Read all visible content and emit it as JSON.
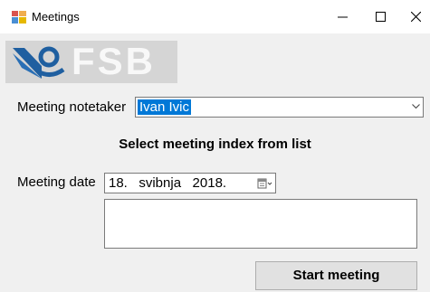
{
  "window": {
    "title": "Meetings",
    "icons": {
      "app": "app-icon",
      "minimize": "minimize-icon",
      "maximize": "maximize-icon",
      "close": "close-icon"
    }
  },
  "logo": {
    "text": "FSB",
    "icon": "fsb-logo-icon"
  },
  "form": {
    "notetaker_label": "Meeting notetaker",
    "notetaker_value": "Ivan Ivic",
    "section_heading": "Select meeting index from list",
    "date_label": "Meeting date",
    "date_value": "18.   svibnja   2018.",
    "start_button_label": "Start meeting"
  },
  "colors": {
    "selection": "#0078d7",
    "background": "#f0f0f0",
    "logo_bg": "#d5d5d5",
    "logo_mark": "#1f5fa0"
  }
}
